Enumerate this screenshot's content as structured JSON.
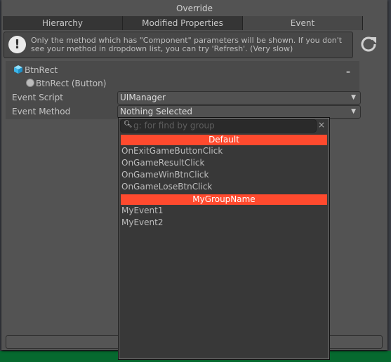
{
  "window": {
    "title": "Override"
  },
  "tabs": [
    {
      "label": "Hierarchy"
    },
    {
      "label": "Modified Properties"
    },
    {
      "label": "Event",
      "active": true
    }
  ],
  "help": {
    "icon": "exclamation-icon",
    "message": "Only the method which has \"Component\" parameters will be shown. If you don't see your method in dropdown list, you can try 'Refresh'. (Very slow)"
  },
  "refresh_icon": "refresh-icon",
  "section": {
    "object_name": "BtnRect",
    "component": "BtnRect (Button)",
    "collapse_label": "–",
    "event_script_label": "Event Script",
    "event_script_value": "UIManager",
    "event_method_label": "Event Method",
    "event_method_value": "Nothing Selected"
  },
  "popup": {
    "search_placeholder": "g: for find by group",
    "clear_label": "×",
    "groups": [
      {
        "name": "Default",
        "items": [
          "OnExitGameButtonClick",
          "OnGameResultClick",
          "OnGameWinBtnClick",
          "OnGameLoseBtnClick"
        ]
      },
      {
        "name": "MyGroupName",
        "items": [
          "MyEvent1",
          "MyEvent2"
        ]
      }
    ]
  },
  "colors": {
    "group_header": "#ff4a2e",
    "popup_bg": "#383838",
    "window_bg": "#535353"
  }
}
